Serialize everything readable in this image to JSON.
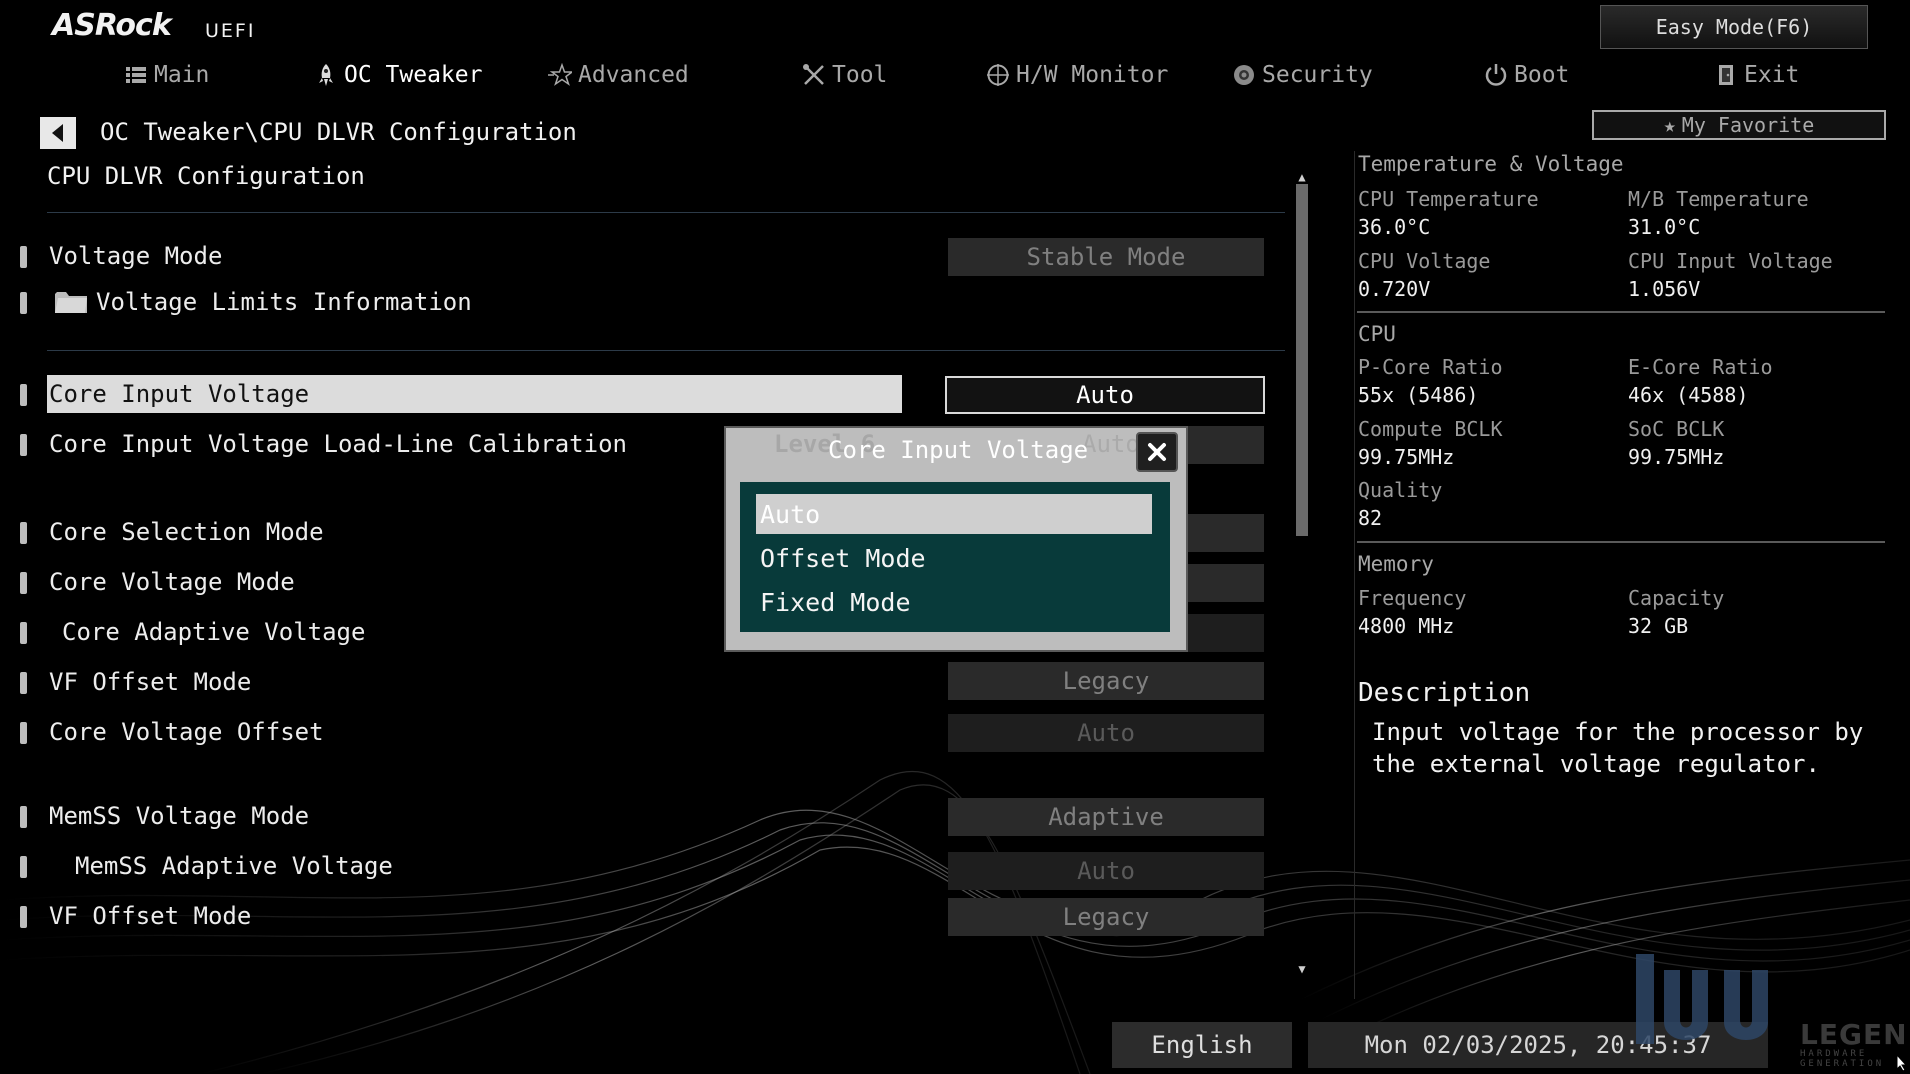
{
  "app": {
    "brand": "ASRock",
    "brand_sub": "UEFI"
  },
  "header": {
    "easy_mode_label": "Easy Mode(F6)",
    "favorite_label": "My Favorite"
  },
  "tabs": [
    {
      "label": "Main",
      "icon": "list-icon",
      "active": false
    },
    {
      "label": "OC Tweaker",
      "icon": "rocket-icon",
      "active": true
    },
    {
      "label": "Advanced",
      "icon": "star-icon",
      "active": false
    },
    {
      "label": "Tool",
      "icon": "tools-icon",
      "active": false
    },
    {
      "label": "H/W Monitor",
      "icon": "monitor-crosshair-icon",
      "active": false
    },
    {
      "label": "Security",
      "icon": "shield-gear-icon",
      "active": false
    },
    {
      "label": "Boot",
      "icon": "power-icon",
      "active": false
    },
    {
      "label": "Exit",
      "icon": "exit-door-icon",
      "active": false
    }
  ],
  "breadcrumb": "OC Tweaker\\CPU DLVR Configuration",
  "page_title": "CPU DLVR Configuration",
  "settings": [
    {
      "label": "Voltage Mode",
      "value": "Stable Mode"
    },
    {
      "label": "Voltage Limits Information",
      "value": ""
    },
    {
      "label": "Core Input Voltage",
      "value": "Auto"
    },
    {
      "label": "Core Input Voltage Load-Line Calibration",
      "value": "Auto"
    },
    {
      "label": "Core Selection Mode",
      "value": ""
    },
    {
      "label": "Core Voltage Mode",
      "value": ""
    },
    {
      "label": "Core Adaptive Voltage",
      "value": ""
    },
    {
      "label": "VF Offset Mode",
      "value": "Legacy"
    },
    {
      "label": "Core Voltage Offset",
      "value": "Auto"
    },
    {
      "label": "MemSS Voltage Mode",
      "value": "Adaptive"
    },
    {
      "label": "MemSS Adaptive Voltage",
      "value": "Auto"
    },
    {
      "label": "VF Offset Mode",
      "value": "Legacy"
    }
  ],
  "popup": {
    "title": "Core Input Voltage",
    "ghost_left": "Level 6",
    "ghost_right": "Auto",
    "options": [
      "Auto",
      "Offset Mode",
      "Fixed Mode"
    ],
    "selected_index": 0
  },
  "monitor": {
    "tv_title": "Temperature & Voltage",
    "cpu_temp_label": "CPU Temperature",
    "cpu_temp": "36.0°C",
    "mb_temp_label": "M/B Temperature",
    "mb_temp": "31.0°C",
    "cpu_volt_label": "CPU Voltage",
    "cpu_volt": "0.720V",
    "cpu_in_volt_label": "CPU Input Voltage",
    "cpu_in_volt": "1.056V",
    "cpu_title": "CPU",
    "pcore_label": "P-Core Ratio",
    "pcore": "55x (5486)",
    "ecore_label": "E-Core Ratio",
    "ecore": "46x (4588)",
    "cbclk_label": "Compute BCLK",
    "cbclk": "99.75MHz",
    "socbclk_label": "SoC BCLK",
    "socbclk": "99.75MHz",
    "quality_label": "Quality",
    "quality": "82",
    "mem_title": "Memory",
    "freq_label": "Frequency",
    "freq": "4800 MHz",
    "cap_label": "Capacity",
    "cap": "32 GB"
  },
  "description": {
    "title": "Description",
    "text": "Input voltage for the processor by the external voltage regulator."
  },
  "footer": {
    "language": "English",
    "datetime": "Mon 02/03/2025, 20:45:37"
  },
  "watermark": {
    "text": "LEGEND",
    "sub": "HARDWARE GENERATION"
  },
  "colors": {
    "background": "#000000",
    "popup_list_bg": "#083a3a",
    "highlight_row": "#dcdcdc"
  }
}
